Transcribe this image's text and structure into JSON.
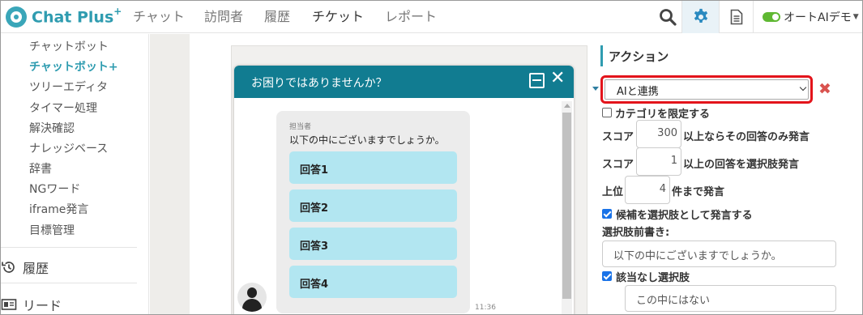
{
  "app": {
    "logo_text": "Chat Plus",
    "logo_sup": "+"
  },
  "nav": {
    "items": [
      "チャット",
      "訪問者",
      "履歴",
      "チケット",
      "レポート"
    ],
    "active_index": 3,
    "icons": [
      "search-icon",
      "gear-icon",
      "document-icon"
    ],
    "demo_label": "オートAIデモ",
    "accent_color": "#2f9cb0"
  },
  "sidebar": {
    "items": [
      "チャットボット",
      "チャットボット+",
      "ツリーエディタ",
      "タイマー処理",
      "解決確認",
      "ナレッジベース",
      "辞書",
      "NGワード",
      "iframe発言",
      "目標管理"
    ],
    "active_index": 1,
    "sections": [
      "履歴",
      "リード"
    ]
  },
  "chat_preview": {
    "header_title": "お困りではありませんか？",
    "header_color": "#117c91",
    "sender": "担当者",
    "message": "以下の中にございますでしょうか。",
    "choices": [
      "回答1",
      "回答2",
      "回答3",
      "回答4"
    ],
    "choice_color": "#b2e6f1",
    "timestamp": "11:36"
  },
  "action_panel": {
    "title": "アクション",
    "action_select": "AIと連携",
    "limit_category_label": "カテゴリを限定する",
    "limit_category_checked": false,
    "score_label": "スコア",
    "score_only_value": "300",
    "score_only_suffix": "以上ならその回答のみ発言",
    "score_choice_value": "1",
    "score_choice_suffix": "以上の回答を選択肢発言",
    "top_label": "上位",
    "top_value": "4",
    "top_suffix": "件まで発言",
    "candidates_label": "候補を選択肢として発言する",
    "candidates_checked": true,
    "preface_label": "選択肢前書き:",
    "preface_value": "以下の中にございますでしょうか。",
    "none_choice_label": "該当なし選択肢",
    "none_choice_checked": true,
    "none_choice_value": "この中にはない",
    "highlight_color": "#e3141b",
    "delete_color": "#d9534f"
  }
}
